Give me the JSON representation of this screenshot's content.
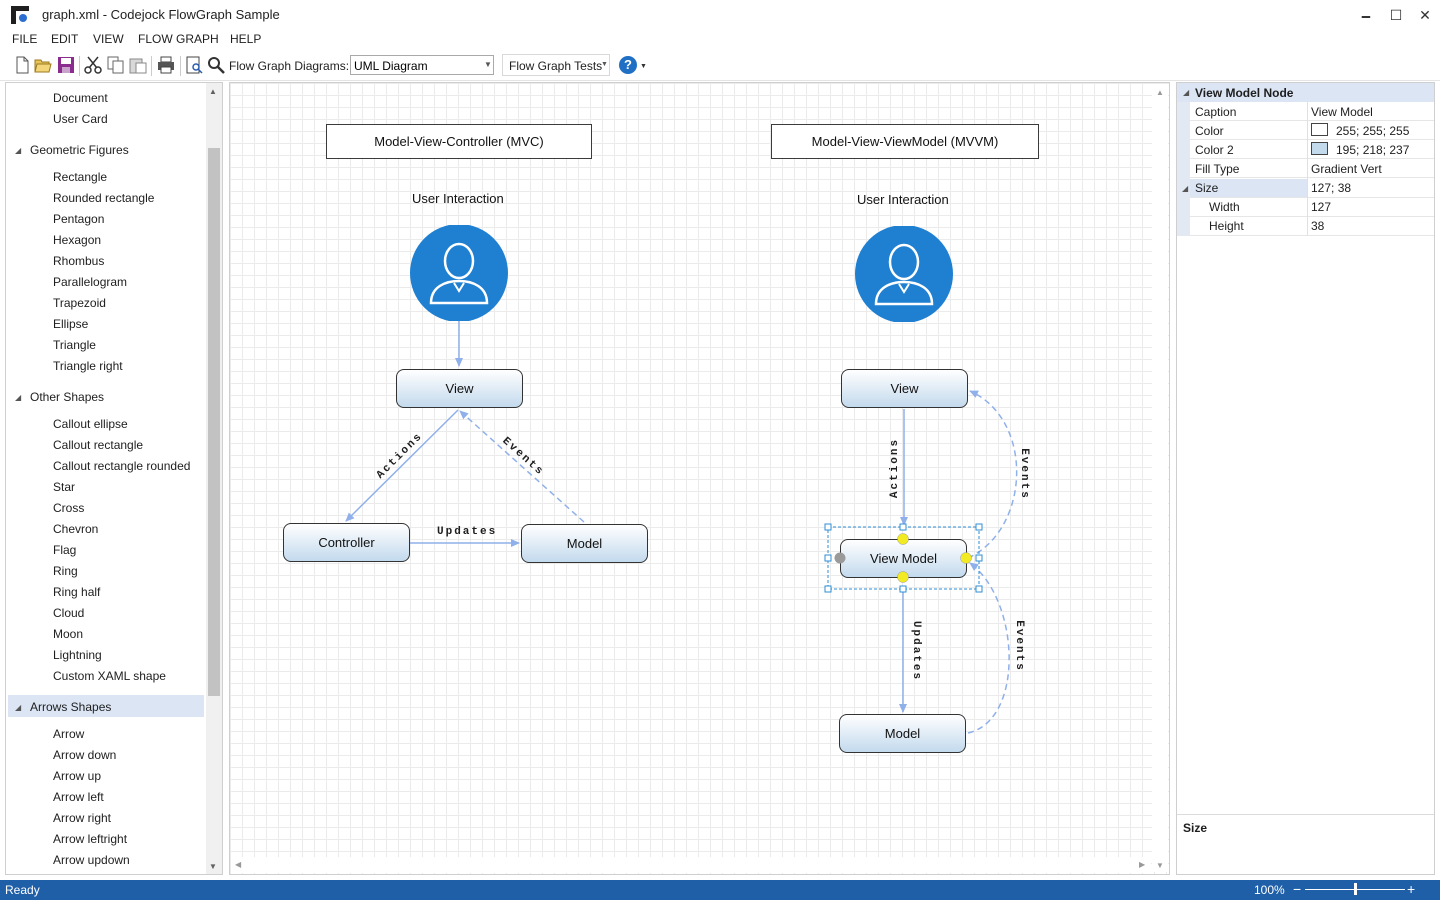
{
  "window": {
    "title": "graph.xml - Codejock FlowGraph Sample",
    "minimize_glyph": "🗕",
    "maximize_glyph": "☐",
    "close_glyph": "✕"
  },
  "menu": {
    "items": [
      "FILE",
      "EDIT",
      "VIEW",
      "FLOW GRAPH",
      "HELP"
    ]
  },
  "toolbar": {
    "icons": [
      "new-icon",
      "open-icon",
      "save-icon",
      "cut-icon",
      "copy-icon",
      "paste-icon",
      "print-icon",
      "print-preview-icon",
      "zoom-icon"
    ],
    "diagrams_label": "Flow Graph Diagrams:",
    "diagrams_value": "UML Diagram",
    "tests_label": "Flow Graph Tests",
    "help_glyph": "?"
  },
  "shapes_tree": {
    "top_items": [
      "Document",
      "User Card"
    ],
    "groups": [
      {
        "label": "Geometric Figures",
        "items": [
          "Rectangle",
          "Rounded rectangle",
          "Pentagon",
          "Hexagon",
          "Rhombus",
          "Parallelogram",
          "Trapezoid",
          "Ellipse",
          "Triangle",
          "Triangle right"
        ]
      },
      {
        "label": "Other Shapes",
        "items": [
          "Callout ellipse",
          "Callout rectangle",
          "Callout rectangle rounded",
          "Star",
          "Cross",
          "Chevron",
          "Flag",
          "Ring",
          "Ring half",
          "Cloud",
          "Moon",
          "Lightning",
          "Custom XAML shape"
        ]
      },
      {
        "label": "Arrows Shapes",
        "items": [
          "Arrow",
          "Arrow down",
          "Arrow up",
          "Arrow left",
          "Arrow right",
          "Arrow leftright",
          "Arrow updown"
        ]
      }
    ],
    "selected_group": "Arrows Shapes"
  },
  "diagram": {
    "mvc": {
      "title": "Model-View-Controller (MVC)",
      "caption": "User Interaction",
      "view": "View",
      "controller": "Controller",
      "model": "Model",
      "label_actions": "Actions",
      "label_events": "Events",
      "label_updates": "Updates"
    },
    "mvvm": {
      "title": "Model-View-ViewModel (MVVM)",
      "caption": "User Interaction",
      "view": "View",
      "view_model": "View Model",
      "model": "Model",
      "label_actions": "Actions",
      "label_events_top": "Events",
      "label_updates": "Updates",
      "label_events_bottom": "Events"
    },
    "colors": {
      "user_circle": "#1f7fd1",
      "connector": "#8fb0ea",
      "selection": "#2e8fd6",
      "handle_yellow": "#f2ea22"
    }
  },
  "properties": {
    "header": "View Model Node",
    "rows": [
      {
        "key": "Caption",
        "value": "View Model"
      },
      {
        "key": "Color",
        "value": "255; 255; 255",
        "swatch": "#ffffff"
      },
      {
        "key": "Color 2",
        "value": "195; 218; 237",
        "swatch": "#c3daed"
      },
      {
        "key": "Fill Type",
        "value": "Gradient Vert"
      },
      {
        "key": "Size",
        "value": "127; 38"
      },
      {
        "key": "Width",
        "value": "127"
      },
      {
        "key": "Height",
        "value": "38"
      }
    ],
    "description_title": "Size"
  },
  "status": {
    "text": "Ready",
    "zoom": "100%",
    "zoom_minus": "−",
    "zoom_plus": "+",
    "zoom_level": 0.5
  }
}
